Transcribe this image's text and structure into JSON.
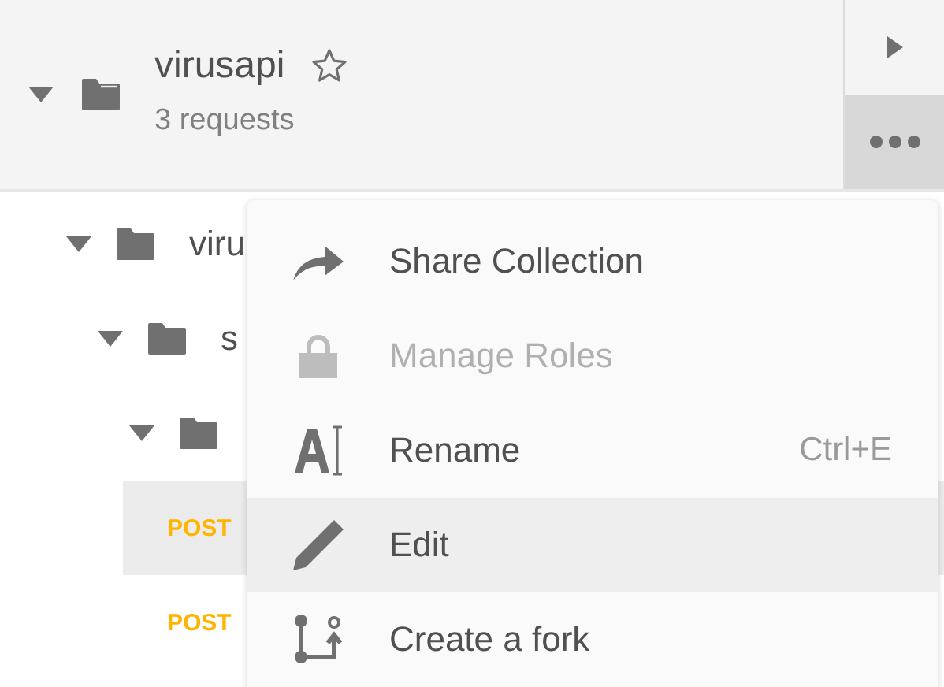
{
  "collection": {
    "name": "virusapi",
    "starred": false,
    "subtitle": "3 requests",
    "expanded": true,
    "menu_open": true
  },
  "tree": [
    {
      "label": "viru",
      "expanded": true,
      "children": [
        {
          "label": "s",
          "expanded": true,
          "children": [
            {
              "expanded": true,
              "children": [
                {
                  "kind": "request",
                  "method": "POST",
                  "selected": true
                },
                {
                  "kind": "request",
                  "method": "POST",
                  "selected": false
                }
              ]
            }
          ]
        }
      ]
    }
  ],
  "menu": [
    {
      "kind": "share",
      "label": "Share Collection",
      "disabled": false,
      "selected": false
    },
    {
      "kind": "roles",
      "label": "Manage Roles",
      "disabled": true,
      "selected": false
    },
    {
      "kind": "rename",
      "label": "Rename",
      "shortcut": "Ctrl+E",
      "disabled": false,
      "selected": false
    },
    {
      "kind": "edit",
      "label": "Edit",
      "disabled": false,
      "selected": true
    },
    {
      "kind": "fork",
      "label": "Create a fork",
      "disabled": false,
      "selected": false
    }
  ]
}
